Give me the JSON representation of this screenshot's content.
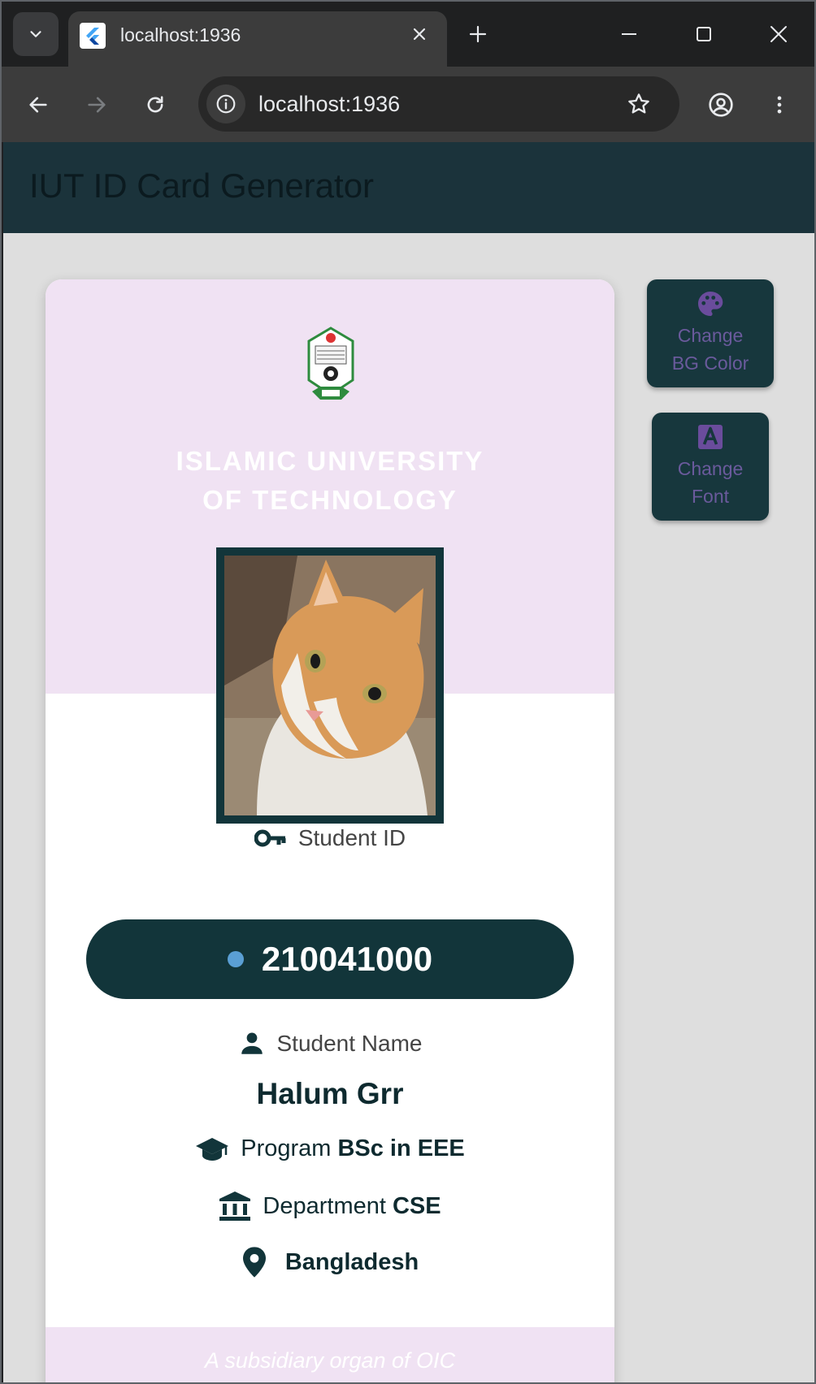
{
  "browser": {
    "tab_title": "localhost:1936",
    "url": "localhost:1936"
  },
  "app": {
    "title": "IUT ID Card Generator"
  },
  "card": {
    "university_name": "ISLAMIC UNIVERSITY OF TECHNOLOGY",
    "student_id_label": "Student ID",
    "student_id": "210041000",
    "student_name_label": "Student Name",
    "student_name": "Halum Grr",
    "program_label": "Program",
    "program": "BSc in EEE",
    "department_label": "Department",
    "department": "CSE",
    "country": "Bangladesh",
    "footer": "A subsidiary organ of OIC"
  },
  "side_buttons": {
    "bg_color_line1": "Change",
    "bg_color_line2": "BG Color",
    "font_line1": "Change",
    "font_line2": "Font"
  },
  "colors": {
    "appbar": "#1b333b",
    "card_accent": "#f0e2f3",
    "dark_teal": "#12353a",
    "button_text": "#6a5a9c"
  }
}
